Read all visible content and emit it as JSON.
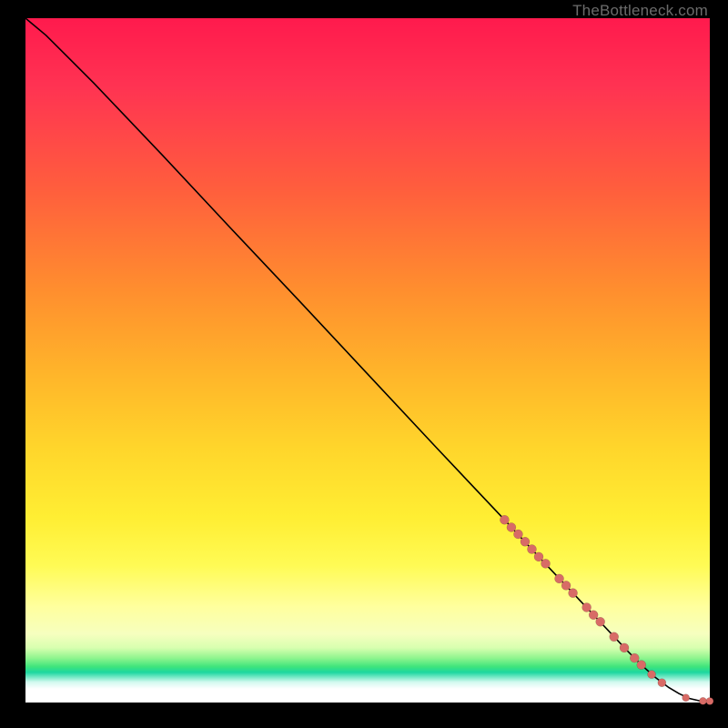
{
  "attribution": "TheBottleneck.com",
  "chart_data": {
    "type": "line",
    "title": "",
    "xlabel": "",
    "ylabel": "",
    "xlim": [
      0,
      100
    ],
    "ylim": [
      0,
      100
    ],
    "grid": false,
    "legend": false,
    "series": [
      {
        "name": "curve",
        "x": [
          0,
          3,
          6,
          10,
          20,
          30,
          40,
          50,
          60,
          70,
          75,
          80,
          85,
          88,
          90,
          92,
          94,
          95.5,
          97,
          98.5,
          100
        ],
        "y": [
          100,
          97.5,
          94.5,
          90.5,
          80,
          69.3,
          58.7,
          48,
          37.3,
          26.7,
          21.3,
          16,
          10.7,
          7.5,
          5.5,
          3.7,
          2.2,
          1.3,
          0.6,
          0.25,
          0.2
        ]
      }
    ],
    "markers": [
      {
        "x": 70.0,
        "y": 26.7,
        "r": 5.0
      },
      {
        "x": 71.0,
        "y": 25.6,
        "r": 5.0
      },
      {
        "x": 72.0,
        "y": 24.6,
        "r": 5.0
      },
      {
        "x": 73.0,
        "y": 23.5,
        "r": 5.0
      },
      {
        "x": 74.0,
        "y": 22.4,
        "r": 5.0
      },
      {
        "x": 75.0,
        "y": 21.3,
        "r": 5.0
      },
      {
        "x": 76.0,
        "y": 20.3,
        "r": 5.0
      },
      {
        "x": 78.0,
        "y": 18.1,
        "r": 5.0
      },
      {
        "x": 79.0,
        "y": 17.1,
        "r": 5.0
      },
      {
        "x": 80.0,
        "y": 16.0,
        "r": 5.0
      },
      {
        "x": 82.0,
        "y": 13.9,
        "r": 5.0
      },
      {
        "x": 83.0,
        "y": 12.8,
        "r": 5.0
      },
      {
        "x": 84.0,
        "y": 11.8,
        "r": 5.0
      },
      {
        "x": 86.0,
        "y": 9.6,
        "r": 5.0
      },
      {
        "x": 87.5,
        "y": 8.0,
        "r": 5.0
      },
      {
        "x": 89.0,
        "y": 6.5,
        "r": 5.0
      },
      {
        "x": 90.0,
        "y": 5.5,
        "r": 5.0
      },
      {
        "x": 91.5,
        "y": 4.1,
        "r": 4.5
      },
      {
        "x": 93.0,
        "y": 2.9,
        "r": 4.5
      },
      {
        "x": 96.5,
        "y": 0.7,
        "r": 4.0
      },
      {
        "x": 99.0,
        "y": 0.22,
        "r": 4.0
      },
      {
        "x": 100.0,
        "y": 0.2,
        "r": 4.0
      }
    ]
  },
  "colors": {
    "marker": "#d86b66",
    "line": "#000000",
    "attribution_text": "#6b6b6b"
  }
}
